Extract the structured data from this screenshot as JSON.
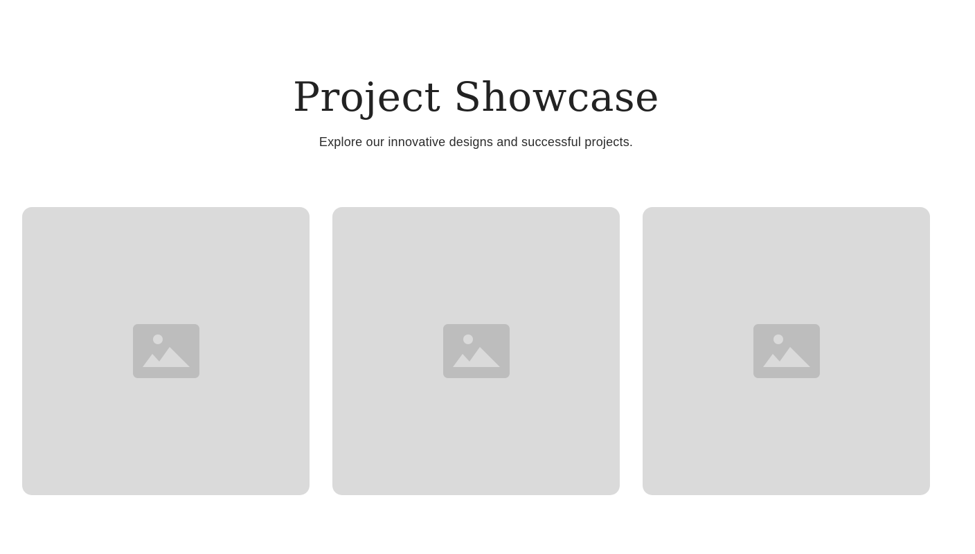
{
  "hero": {
    "title": "Project Showcase",
    "subtitle": "Explore our innovative designs and successful projects."
  },
  "gallery": {
    "items": [
      {
        "icon": "image-placeholder-icon"
      },
      {
        "icon": "image-placeholder-icon"
      },
      {
        "icon": "image-placeholder-icon"
      }
    ]
  },
  "colors": {
    "background": "#ffffff",
    "card": "#dadada",
    "icon_frame": "#bdbdbd",
    "icon_glyph": "#dadada",
    "text": "#222222"
  }
}
